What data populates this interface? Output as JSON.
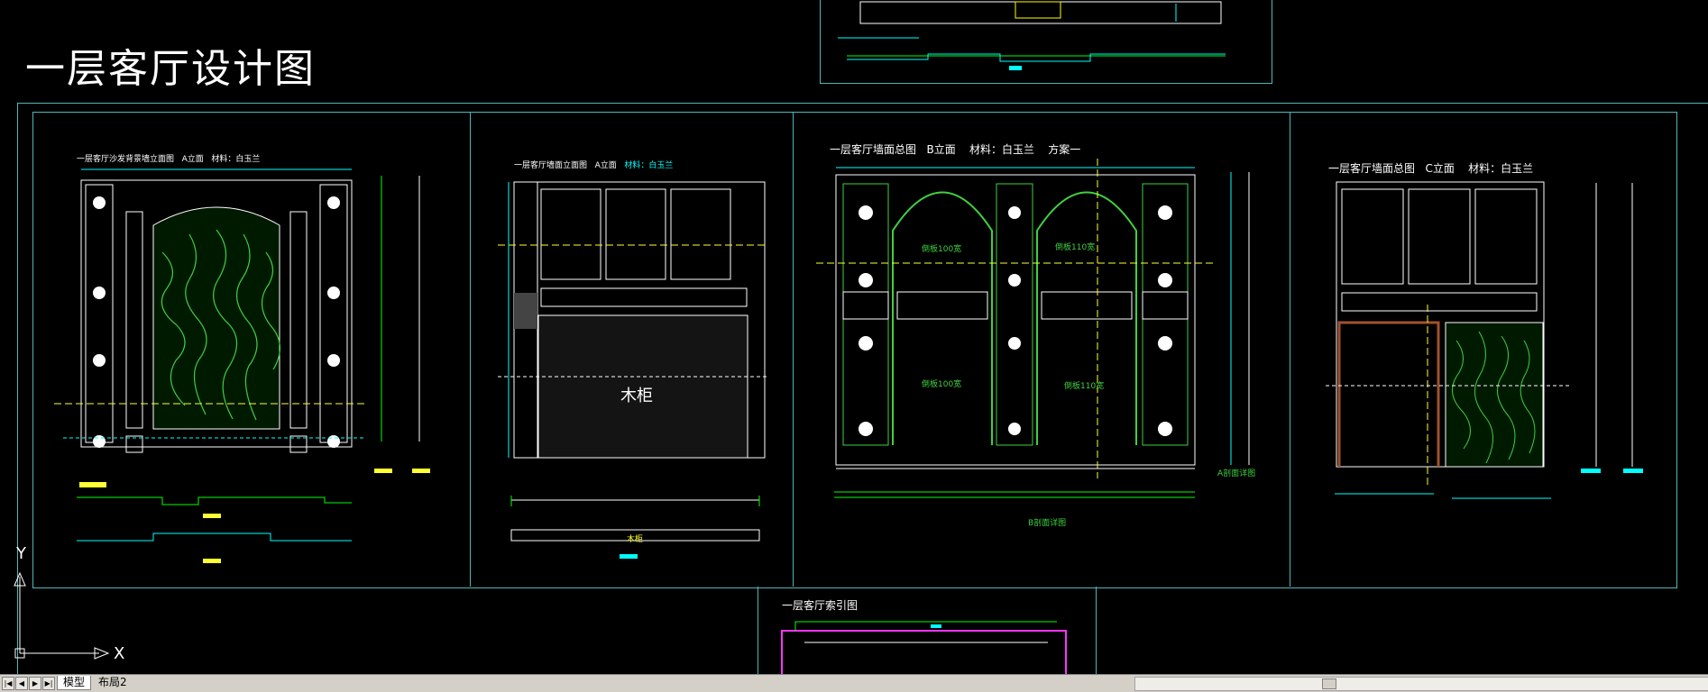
{
  "drawing": {
    "main_title": "一层客厅设计图",
    "panel_a": {
      "title": "一层客厅沙发背景墙立面图",
      "view": "A立面",
      "material": "材料：白玉兰"
    },
    "panel_b": {
      "title": "一层客厅墙面立面图",
      "view": "A立面",
      "material": "材料：白玉兰",
      "cabinet_label": "木柜",
      "section_label": "木柜"
    },
    "panel_c": {
      "title": "一层客厅墙面总图",
      "view": "B立面",
      "material": "材料：白玉兰",
      "scheme": "方案一",
      "tag_top_left": "倒板100宽",
      "tag_top_right": "倒板110宽",
      "tag_bot_left": "倒板100宽",
      "tag_bot_right": "倒板110宽",
      "right_note": "A剖面详图",
      "bottom_note": "B剖面详图"
    },
    "panel_d": {
      "title": "一层客厅墙面总图",
      "view": "C立面",
      "material": "材料：白玉兰"
    },
    "index_title": "一层客厅索引图",
    "axis": {
      "x": "X",
      "y": "Y"
    }
  },
  "statusbar": {
    "tabs": [
      {
        "label": "模型"
      },
      {
        "label": "布局2"
      }
    ],
    "nav": {
      "first": "|◀",
      "prev": "◀",
      "next": "▶",
      "last": "▶|"
    }
  },
  "colors": {
    "background": "#000000",
    "frame": "#4fb7b7",
    "cyan": "#00ffff",
    "green": "#3fd03f",
    "yellow": "#ffff33",
    "magenta": "#ff33ff"
  }
}
